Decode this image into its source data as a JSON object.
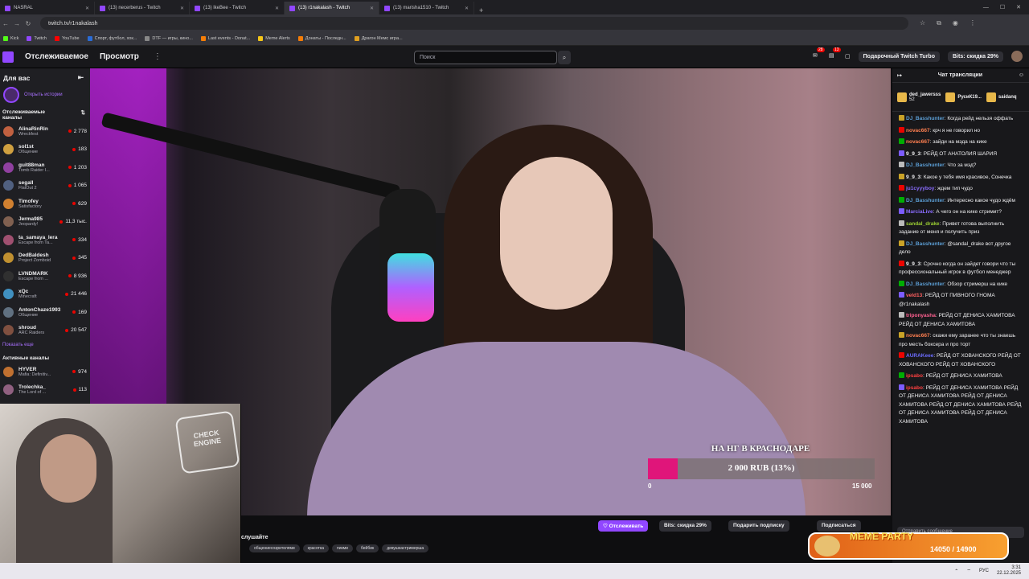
{
  "browser": {
    "tabs": [
      {
        "title": "NASRAL",
        "active": false
      },
      {
        "title": "(13) necerberus - Twitch",
        "active": false
      },
      {
        "title": "(13) lkeBee - Twitch",
        "active": false
      },
      {
        "title": "(13) r1nakalash - Twitch",
        "active": true
      },
      {
        "title": "(13) marisha1510 - Twitch",
        "active": false
      }
    ],
    "url": "twitch.tv/r1nakalash",
    "bookmarks": [
      "Kick",
      "Twitch",
      "YouTube",
      "Спорт, футбол, хок...",
      "DTF — игры, кино...",
      "Last events - Donat...",
      "Meme Alerts",
      "Донаты - Последн...",
      "Драгон Мемс игра..."
    ]
  },
  "topnav": {
    "following": "Отслеживаемое",
    "browse": "Просмотр",
    "search_placeholder": "Поиск",
    "notif_badge_1": "28",
    "notif_badge_2": "13",
    "gift_turbo": "Подарочный Twitch Turbo",
    "bits_sale": "Bits: скидка 29%"
  },
  "sidebar": {
    "for_you": "Для вас",
    "open_stories": "Открыть истории",
    "followed_title": "Отслеживаемые каналы",
    "channels": [
      {
        "name": "AlinaRinRin",
        "game": "Wreckfest",
        "viewers": "2 778",
        "color": "#c06040"
      },
      {
        "name": "sol1st",
        "game": "Общение",
        "viewers": "183",
        "color": "#d0a040"
      },
      {
        "name": "guit88man",
        "game": "Tomb Raider I...",
        "viewers": "1 203",
        "color": "#9040a0"
      },
      {
        "name": "segall",
        "game": "FlatOut 2",
        "viewers": "1 065",
        "color": "#506080"
      },
      {
        "name": "Timofey",
        "game": "Satisfactory",
        "viewers": "629",
        "color": "#d08030"
      },
      {
        "name": "Jerma985",
        "game": "Jeopardy!",
        "viewers": "11,3 тыс.",
        "color": "#806050"
      },
      {
        "name": "ta_samaya_lera",
        "game": "Escape from Ta...",
        "viewers": "334",
        "color": "#a05070"
      },
      {
        "name": "DedBaldesh",
        "game": "Project Zomboid",
        "viewers": "345",
        "color": "#c09030"
      },
      {
        "name": "LVNDMARK",
        "game": "Escape from ...",
        "viewers": "8 936",
        "color": "#303030"
      },
      {
        "name": "xQc",
        "game": "Minecraft",
        "viewers": "21 446",
        "color": "#4090c0"
      },
      {
        "name": "AntonChaze1993",
        "game": "Общение",
        "viewers": "169",
        "color": "#607080"
      },
      {
        "name": "shroud",
        "game": "ARC Raiders",
        "viewers": "20 547",
        "color": "#805040"
      }
    ],
    "show_more": "Показать еще",
    "active_title": "Активные каналы",
    "active_channels": [
      {
        "name": "HYVER",
        "game": "Mafia: Definitiv...",
        "viewers": "974",
        "color": "#c07030"
      },
      {
        "name": "Trolechka_",
        "game": "The Lord of ...",
        "viewers": "113",
        "color": "#906080"
      }
    ]
  },
  "video": {
    "cam_sign": "CHECK ENGINE",
    "goal": {
      "title": "НА НГ В КРАСНОДАРЕ",
      "progress_text": "2 000 RUB (13%)",
      "fraction": 0.13,
      "min": "0",
      "max": "15 000"
    }
  },
  "info": {
    "listen": "слушайте",
    "follow": "Отслеживать",
    "bits": "Bits: скидка 29%",
    "gift_sub": "Подарить подписку",
    "subscribe": "Подписаться",
    "tags": [
      "общениесозрителями",
      "красотка",
      "пикми",
      "бейбик",
      "девушкастримерша"
    ]
  },
  "chat": {
    "title": "Чат трансляции",
    "leaders": [
      {
        "name": "ded_jawersss",
        "count": "52"
      },
      {
        "name": "РусиК19...",
        "count": ""
      },
      {
        "name": "saidanq",
        "count": ""
      }
    ],
    "messages": [
      {
        "user": "DJ_Basshunter",
        "color": "#5c9fd6",
        "text": "Когда рейд нельзя оффать"
      },
      {
        "user": "novac667",
        "color": "#ff7f50",
        "text": "крч я не говорил но"
      },
      {
        "user": "novac667",
        "color": "#ff7f50",
        "text": "зайди на мэда на кике"
      },
      {
        "user": "9_9_3",
        "color": "#efeff1",
        "text": "РЕЙД ОТ АНАТОЛИЯ ШАРИЯ"
      },
      {
        "user": "DJ_Basshunter",
        "color": "#5c9fd6",
        "text": "Что за мэд?"
      },
      {
        "user": "9_9_3",
        "color": "#efeff1",
        "text": "Какое у тебя имя красивое, Сонечка"
      },
      {
        "user": "ju1cyyyboy",
        "color": "#8a6cff",
        "text": "ждем тип чудо"
      },
      {
        "user": "DJ_Basshunter",
        "color": "#5c9fd6",
        "text": "Интересно какое чудо ждём"
      },
      {
        "user": "MarciaLive",
        "color": "#8a6cff",
        "text": "А чего он на кике стримит?"
      },
      {
        "user": "sandal_drake",
        "color": "#9acd32",
        "text": "Привет готова выполнить задание от меня и получить приз"
      },
      {
        "user": "DJ_Basshunter",
        "color": "#5c9fd6",
        "text": "@sandal_drake вот другое дело"
      },
      {
        "user": "9_9_3",
        "color": "#efeff1",
        "text": "Срочно когда он зайдет говори что ты профессиональный игрок в футбол менеджер"
      },
      {
        "user": "DJ_Basshunter",
        "color": "#5c9fd6",
        "text": "Обзор стримерш на кике"
      },
      {
        "user": "veld13",
        "color": "#ff6060",
        "text": "РЕЙД ОТ ПИВНОГО ГНОМА @r1nakalash"
      },
      {
        "user": "triponyasha",
        "color": "#ff6090",
        "text": "РЕЙД ОТ ДЕНИСА ХАМИТОВА РЕЙД ОТ ДЕНИСА ХАМИТОВА"
      },
      {
        "user": "novac667",
        "color": "#ff7f50",
        "text": "скажи ему заранее что ты знаешь про месть боксера и про торт"
      },
      {
        "user": "AURAKeee",
        "color": "#6c6cff",
        "text": "РЕЙД ОТ ХОВАНСКОГО РЕЙД ОТ ХОВАНСКОГО РЕЙД ОТ ХОВАНСКОГО"
      },
      {
        "user": "ipsabo",
        "color": "#ff4040",
        "text": "РЕЙД ОТ ДЕНИСА ХАМИТОВА"
      },
      {
        "user": "ipsabo",
        "color": "#ff4040",
        "text": "РЕЙД ОТ ДЕНИСА ХАМИТОВА РЕЙД ОТ ДЕНИСА ХАМИТОВА РЕЙД ОТ ДЕНИСА ХАМИТОВА РЕЙД ОТ ДЕНИСА ХАМИТОВА РЕЙД ОТ ДЕНИСА ХАМИТОВА РЕЙД ОТ ДЕНИСА ХАМИТОВА"
      }
    ],
    "input_placeholder": "Отправить сообщение",
    "send": "Чат"
  },
  "meme_party": {
    "title": "MEME PARTY",
    "count": "14050 / 14900"
  },
  "taskbar": {
    "lang": "РУС",
    "time": "3:31",
    "date": "22.12.2025"
  }
}
